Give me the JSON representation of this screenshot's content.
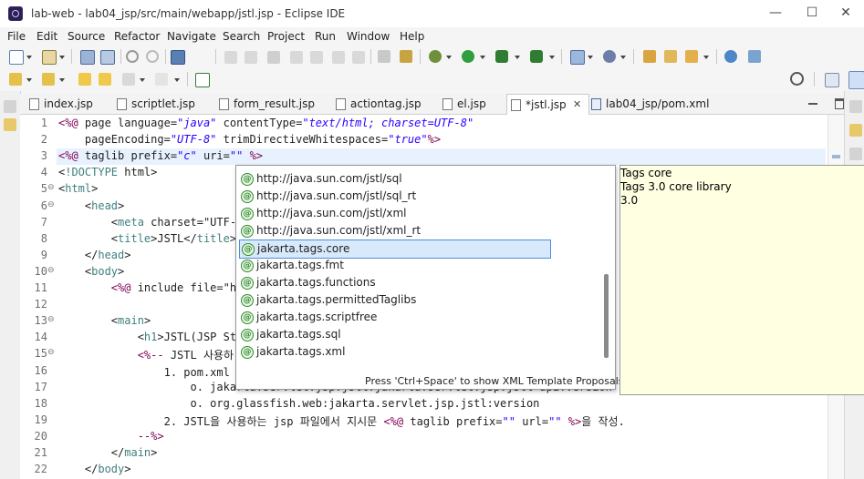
{
  "window": {
    "title": "lab-web - lab04_jsp/src/main/webapp/jstl.jsp - Eclipse IDE",
    "controls": {
      "minimize": "—",
      "maximize": "☐",
      "close": "✕"
    }
  },
  "menu": [
    "File",
    "Edit",
    "Source",
    "Refactor",
    "Navigate",
    "Search",
    "Project",
    "Run",
    "Window",
    "Help"
  ],
  "tabs": [
    {
      "label": "index.jsp",
      "active": false
    },
    {
      "label": "scriptlet.jsp",
      "active": false
    },
    {
      "label": "form_result.jsp",
      "active": false
    },
    {
      "label": "actiontag.jsp",
      "active": false
    },
    {
      "label": "el.jsp",
      "active": false
    },
    {
      "label": "*jstl.jsp",
      "active": true,
      "close": "✕"
    },
    {
      "label": "lab04_jsp/pom.xml",
      "active": false
    }
  ],
  "editor": {
    "lines": [
      {
        "n": "1",
        "fold": "",
        "text": "<%@ page language=\"java\" contentType=\"text/html; charset=UTF-8\""
      },
      {
        "n": "2",
        "fold": "",
        "text": "    pageEncoding=\"UTF-8\" trimDirectiveWhitespaces=\"true\"%>"
      },
      {
        "n": "3",
        "fold": "",
        "text": "<%@ taglib prefix=\"c\" uri=\"\" %>"
      },
      {
        "n": "4",
        "fold": "",
        "text": "<!DOCTYPE html>"
      },
      {
        "n": "5",
        "fold": "⊖",
        "text": "<html>"
      },
      {
        "n": "6",
        "fold": "⊖",
        "text": "    <head>"
      },
      {
        "n": "7",
        "fold": "",
        "text": "        <meta charset=\"UTF-8"
      },
      {
        "n": "8",
        "fold": "",
        "text": "        <title>JSTL</title>"
      },
      {
        "n": "9",
        "fold": "",
        "text": "    </head>"
      },
      {
        "n": "10",
        "fold": "⊖",
        "text": "    <body>"
      },
      {
        "n": "11",
        "fold": "",
        "text": "        <%@ include file=\"he"
      },
      {
        "n": "12",
        "fold": "",
        "text": ""
      },
      {
        "n": "13",
        "fold": "⊖",
        "text": "        <main>"
      },
      {
        "n": "14",
        "fold": "",
        "text": "            <h1>JSTL(JSP Sta"
      },
      {
        "n": "15",
        "fold": "⊖",
        "text": "            <%-- JSTL 사용하"
      },
      {
        "n": "16",
        "fold": "",
        "text": "                1. pom.xml 파"
      },
      {
        "n": "17",
        "fold": "",
        "text": "                    o. jakarta.servlet.jsp.jstl:jakarta.servlet.jsp.jstl-api:version"
      },
      {
        "n": "18",
        "fold": "",
        "text": "                    o. org.glassfish.web:jakarta.servlet.jsp.jstl:version"
      },
      {
        "n": "19",
        "fold": "",
        "text": "                2. JSTL을 사용하는 jsp 파일에서 지시문 <%@ taglib prefix=\"\" url=\"\" %>을 작성."
      },
      {
        "n": "20",
        "fold": "",
        "text": "            --%>"
      },
      {
        "n": "21",
        "fold": "",
        "text": "        </main>"
      },
      {
        "n": "22",
        "fold": "",
        "text": "    </body>"
      }
    ]
  },
  "autocomplete": {
    "items": [
      "http://java.sun.com/jstl/sql",
      "http://java.sun.com/jstl/sql_rt",
      "http://java.sun.com/jstl/xml",
      "http://java.sun.com/jstl/xml_rt",
      "jakarta.tags.core",
      "jakarta.tags.fmt",
      "jakarta.tags.functions",
      "jakarta.tags.permittedTaglibs",
      "jakarta.tags.scriptfree",
      "jakarta.tags.sql",
      "jakarta.tags.xml"
    ],
    "selected_index": 4,
    "item_icon": "@",
    "status": "Press 'Ctrl+Space' to show XML Template Proposals"
  },
  "info": {
    "line1": "Tags core",
    "line2": "Tags 3.0 core library",
    "line3": "3.0"
  },
  "colors": {
    "keyword": "#7f0055",
    "string": "#2a00ff",
    "selection": "#d7e9fb",
    "info_background": "#ffffe1"
  }
}
